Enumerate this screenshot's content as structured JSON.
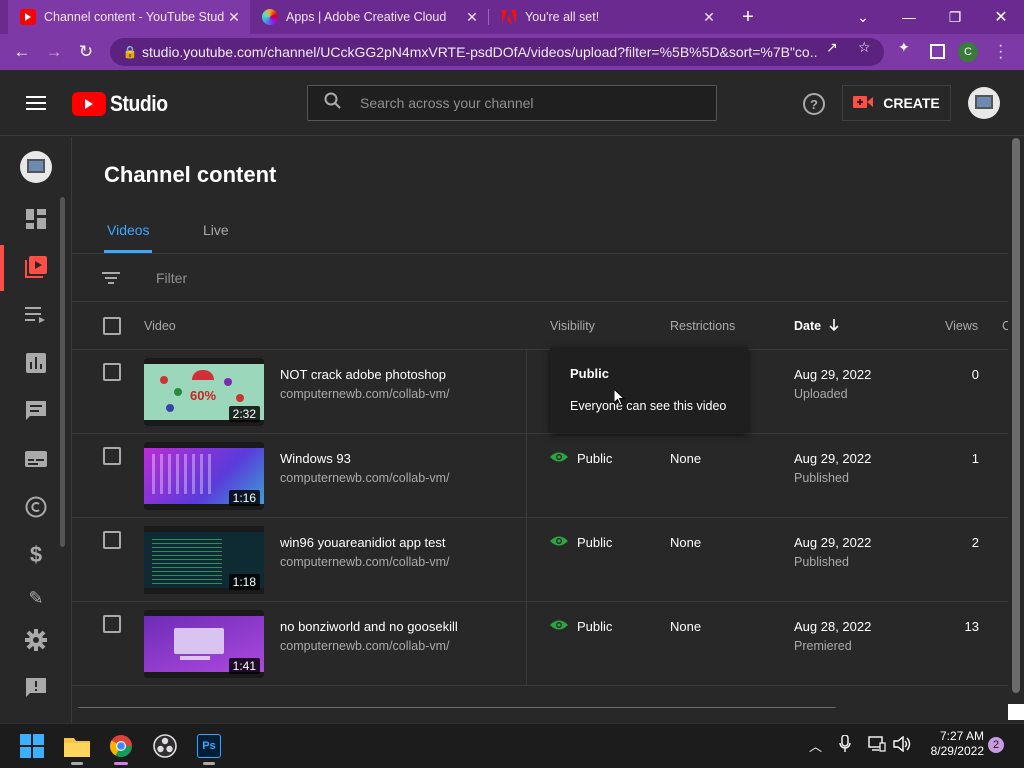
{
  "browser": {
    "tabs": [
      {
        "title": "Channel content - YouTube Studio",
        "favicon": "youtube-favicon",
        "active": true
      },
      {
        "title": "Apps | Adobe Creative Cloud",
        "favicon": "creative-cloud-favicon",
        "active": false
      },
      {
        "title": "You're all set!",
        "favicon": "adobe-favicon",
        "active": false
      }
    ],
    "new_tab": "+",
    "url": "studio.youtube.com/channel/UCckGG2pN4mxVRTE-psdDOfA/videos/upload?filter=%5B%5D&sort=%7B\"co...",
    "profile_initial": "C"
  },
  "header": {
    "logo_text": "Studio",
    "search_placeholder": "Search across your channel",
    "create_label": "CREATE"
  },
  "page": {
    "title": "Channel content",
    "tabs": [
      {
        "label": "Videos",
        "active": true
      },
      {
        "label": "Live",
        "active": false
      }
    ],
    "filter_placeholder": "Filter"
  },
  "table": {
    "columns": {
      "video": "Video",
      "visibility": "Visibility",
      "restrictions": "Restrictions",
      "date": "Date",
      "views": "Views",
      "comments": "C"
    },
    "rows": [
      {
        "title": "NOT crack adobe photoshop",
        "description": "computernewb.com/collab-vm/",
        "duration": "2:32",
        "thumb_text": "60%",
        "visibility": "",
        "restrictions": "",
        "date": "Aug 29, 2022",
        "status": "Uploaded",
        "views": "0"
      },
      {
        "title": "Windows 93",
        "description": "computernewb.com/collab-vm/",
        "duration": "1:16",
        "thumb_text": "",
        "visibility": "Public",
        "restrictions": "None",
        "date": "Aug 29, 2022",
        "status": "Published",
        "views": "1"
      },
      {
        "title": "win96 youareanidiot app test",
        "description": "computernewb.com/collab-vm/",
        "duration": "1:18",
        "thumb_text": "",
        "visibility": "Public",
        "restrictions": "None",
        "date": "Aug 29, 2022",
        "status": "Published",
        "views": "2"
      },
      {
        "title": "no bonziworld and no goosekill",
        "description": "computernewb.com/collab-vm/",
        "duration": "1:41",
        "thumb_text": "",
        "visibility": "Public",
        "restrictions": "None",
        "date": "Aug 28, 2022",
        "status": "Premiered",
        "views": "13"
      }
    ]
  },
  "tooltip": {
    "title": "Public",
    "body": "Everyone can see this video"
  },
  "taskbar": {
    "time": "7:27 AM",
    "date": "8/29/2022",
    "notifications": "2",
    "ps_label": "Ps"
  },
  "colors": {
    "accent_blue": "#3ea6ff",
    "youtube_red": "#ff0000",
    "public_green": "#2ba640",
    "chrome_purple": "#7d3aa6"
  }
}
